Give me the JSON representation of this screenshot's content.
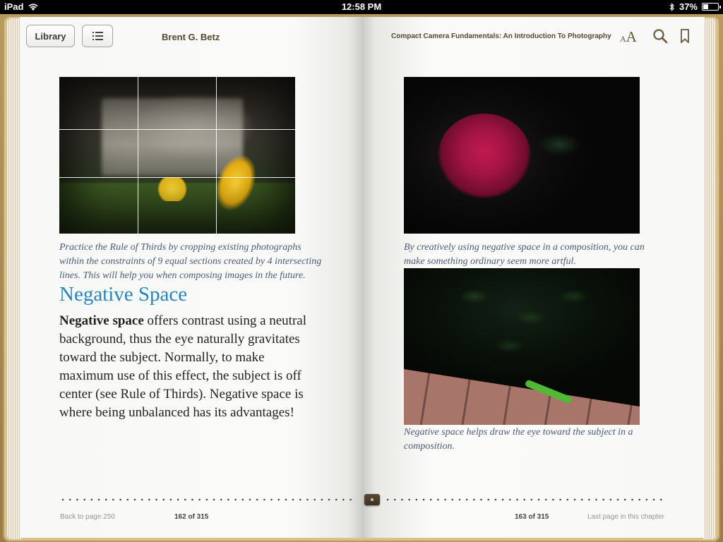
{
  "status_bar": {
    "device": "iPad",
    "time": "12:58 PM",
    "battery": "37%",
    "battery_level": 0.37
  },
  "toolbar": {
    "library_label": "Library",
    "toc_icon": "list-icon",
    "author": "Brent G. Betz",
    "book_title": "Compact Camera Fundamentals: An Introduction To Photography",
    "font_small": "A",
    "font_big": "A",
    "search_icon": "search-icon",
    "bookmark_icon": "bookmark-icon"
  },
  "left_page": {
    "caption": "Practice the Rule of Thirds by cropping existing photographs within the constraints of 9 equal sections created by 4 intersecting lines. This will help you when composing images in the future.",
    "heading": "Negative Space",
    "body_bold": "Negative space",
    "body_text": " offers contrast using a neutral background, thus the eye naturally gravitates toward the subject.  Normally, to make maximum use of this effect, the subject is off center (see Rule of Thirds).  Negative space is where being unbalanced has its advantages!"
  },
  "right_page": {
    "caption1": "By creatively using negative space in a composition, you can make something ordinary seem more artful.",
    "caption2": "Negative space helps draw the eye toward the subject in a composition."
  },
  "footer": {
    "back_link": "Back to page 250",
    "left_page_num": "162 of 315",
    "right_page_num": "163 of 315",
    "last_page": "Last page in this chapter"
  },
  "colors": {
    "heading": "#2086c6",
    "caption": "#4a5b7a",
    "toolbar_text": "#5a4633"
  }
}
